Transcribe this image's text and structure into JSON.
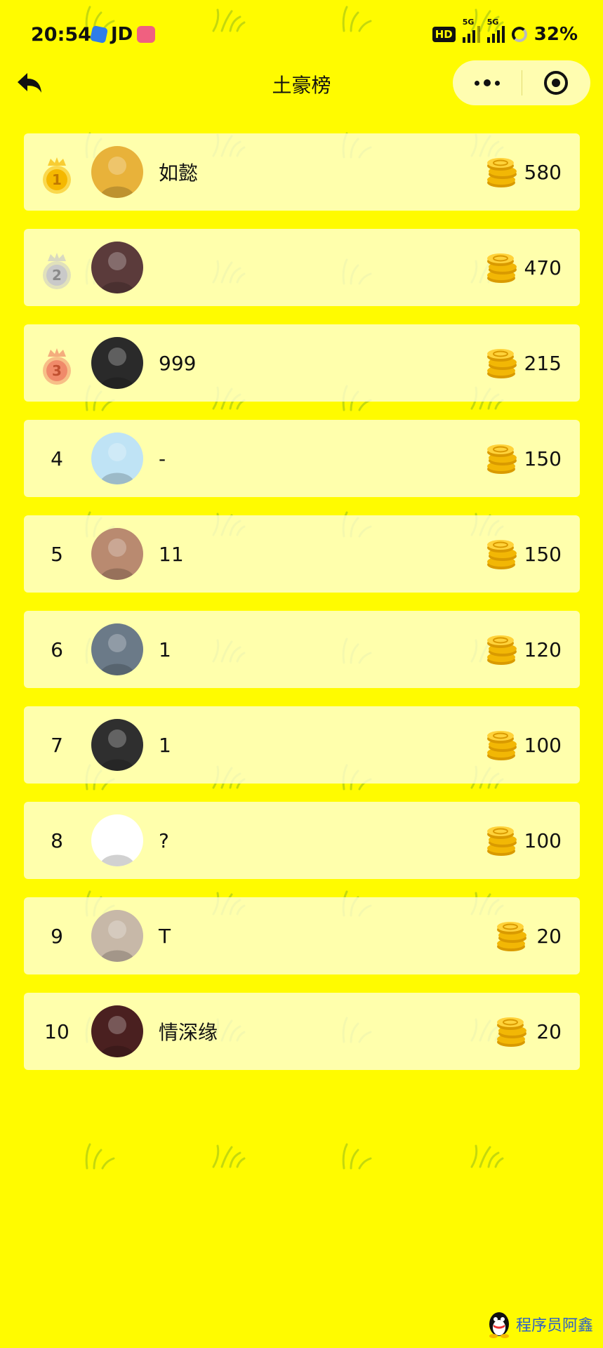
{
  "status_bar": {
    "time": "20:54",
    "app_label": "JD",
    "hd": "HD",
    "signal_tag_1": "5G",
    "signal_tag_2": "5G",
    "battery": "32%"
  },
  "nav": {
    "title": "土豪榜",
    "icons": [
      "back-arrow-icon",
      "more-dots-icon",
      "close-target-icon"
    ]
  },
  "colors": {
    "background": "#fffb00",
    "card": "#ffffd2",
    "gold_medal": "#f5b800",
    "silver_medal": "#c9c9c9",
    "bronze_medal": "#f08a6a",
    "coin": "#f2b705"
  },
  "leaderboard": [
    {
      "rank": "1",
      "name": "如懿",
      "score": "580",
      "avatar": "#e8b23a"
    },
    {
      "rank": "2",
      "name": "",
      "score": "470",
      "avatar": "#5b3b3b"
    },
    {
      "rank": "3",
      "name": "999",
      "score": "215",
      "avatar": "#2a2a2a"
    },
    {
      "rank": "4",
      "name": "-",
      "score": "150",
      "avatar": "#bfe3f5"
    },
    {
      "rank": "5",
      "name": "11",
      "score": "150",
      "avatar": "#b98a70"
    },
    {
      "rank": "6",
      "name": "1",
      "score": "120",
      "avatar": "#6b7a88"
    },
    {
      "rank": "7",
      "name": "1",
      "score": "100",
      "avatar": "#2f2f2f"
    },
    {
      "rank": "8",
      "name": "?",
      "score": "100",
      "avatar": "#ffffff"
    },
    {
      "rank": "9",
      "name": "T",
      "score": "20",
      "avatar": "#c7b8a8"
    },
    {
      "rank": "10",
      "name": "情深缘",
      "score": "20",
      "avatar": "#4a2020"
    }
  ],
  "watermark": "程序员阿鑫"
}
